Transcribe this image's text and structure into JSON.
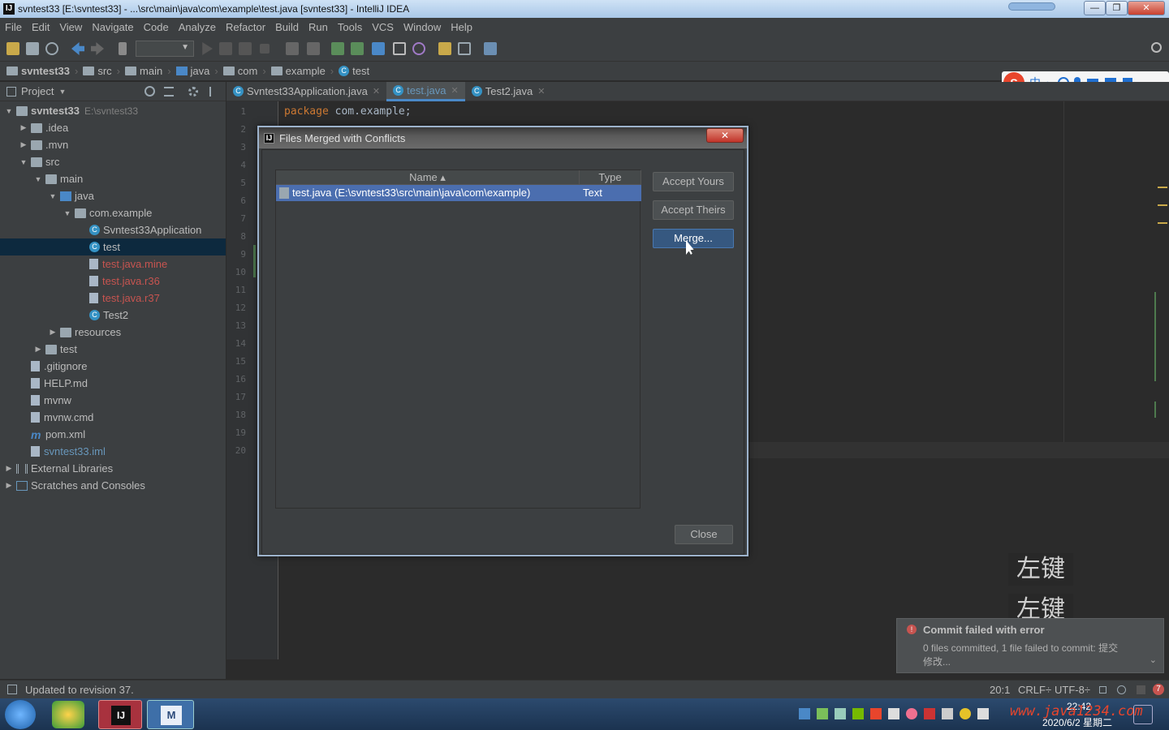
{
  "window": {
    "title": "svntest33 [E:\\svntest33] - ...\\src\\main\\java\\com\\example\\test.java [svntest33] - IntelliJ IDEA",
    "minimize": "—",
    "maximize": "❐",
    "close": "✕"
  },
  "menu": [
    "File",
    "Edit",
    "View",
    "Navigate",
    "Code",
    "Analyze",
    "Refactor",
    "Build",
    "Run",
    "Tools",
    "VCS",
    "Window",
    "Help"
  ],
  "breadcrumb": [
    "svntest33",
    "src",
    "main",
    "java",
    "com",
    "example",
    "test"
  ],
  "project_panel": {
    "title": "Project",
    "tree": [
      {
        "label": "svntest33",
        "extra": "E:\\svntest33",
        "indent": 0,
        "arrow": "▼",
        "icon": "module",
        "style": "bold"
      },
      {
        "label": ".idea",
        "indent": 1,
        "arrow": "▶",
        "icon": "folder"
      },
      {
        "label": ".mvn",
        "indent": 1,
        "arrow": "▶",
        "icon": "folder"
      },
      {
        "label": "src",
        "indent": 1,
        "arrow": "▼",
        "icon": "folder"
      },
      {
        "label": "main",
        "indent": 2,
        "arrow": "▼",
        "icon": "folder"
      },
      {
        "label": "java",
        "indent": 3,
        "arrow": "▼",
        "icon": "folder-blue"
      },
      {
        "label": "com.example",
        "indent": 4,
        "arrow": "▼",
        "icon": "package"
      },
      {
        "label": "Svntest33Application",
        "indent": 5,
        "arrow": "",
        "icon": "class"
      },
      {
        "label": "test",
        "indent": 5,
        "arrow": "",
        "icon": "class",
        "selected": true
      },
      {
        "label": "test.java.mine",
        "indent": 5,
        "arrow": "",
        "icon": "file",
        "style": "red"
      },
      {
        "label": "test.java.r36",
        "indent": 5,
        "arrow": "",
        "icon": "file",
        "style": "red"
      },
      {
        "label": "test.java.r37",
        "indent": 5,
        "arrow": "",
        "icon": "file",
        "style": "red"
      },
      {
        "label": "Test2",
        "indent": 5,
        "arrow": "",
        "icon": "class"
      },
      {
        "label": "resources",
        "indent": 3,
        "arrow": "▶",
        "icon": "folder"
      },
      {
        "label": "test",
        "indent": 2,
        "arrow": "▶",
        "icon": "folder"
      },
      {
        "label": ".gitignore",
        "indent": 1,
        "arrow": "",
        "icon": "file"
      },
      {
        "label": "HELP.md",
        "indent": 1,
        "arrow": "",
        "icon": "file"
      },
      {
        "label": "mvnw",
        "indent": 1,
        "arrow": "",
        "icon": "file"
      },
      {
        "label": "mvnw.cmd",
        "indent": 1,
        "arrow": "",
        "icon": "file"
      },
      {
        "label": "pom.xml",
        "indent": 1,
        "arrow": "",
        "icon": "maven"
      },
      {
        "label": "svntest33.iml",
        "indent": 1,
        "arrow": "",
        "icon": "file",
        "style": "blue"
      },
      {
        "label": "External Libraries",
        "indent": 0,
        "arrow": "▶",
        "icon": "libs"
      },
      {
        "label": "Scratches and Consoles",
        "indent": 0,
        "arrow": "▶",
        "icon": "scratch"
      }
    ]
  },
  "tabs": [
    {
      "label": "Svntest33Application.java",
      "active": false
    },
    {
      "label": "test.java",
      "active": true
    },
    {
      "label": "Test2.java",
      "active": false
    }
  ],
  "editor": {
    "line_numbers": [
      "1",
      "2",
      "3",
      "4",
      "5",
      "6",
      "7",
      "8",
      "9",
      "10",
      "11",
      "12",
      "13",
      "14",
      "15",
      "16",
      "17",
      "18",
      "19",
      "20"
    ],
    "code_keyword": "package",
    "code_rest": " com.example;"
  },
  "dialog": {
    "title": "Files Merged with Conflicts",
    "close": "✕",
    "col_name": "Name ▴",
    "col_type": "Type",
    "row_file": "test.java (E:\\svntest33\\src\\main\\java\\com\\example)",
    "row_type": "Text",
    "accept_yours": "Accept Yours",
    "accept_theirs": "Accept Theirs",
    "merge": "Merge...",
    "close_button": "Close"
  },
  "notification": {
    "title": "Commit failed with error",
    "body": "0 files committed, 1 file failed to commit: 提交",
    "body2": "修改..."
  },
  "overlay_keys": [
    "左键",
    "左键"
  ],
  "ime": {
    "logo": "S",
    "mode": "中",
    "punct": "•,"
  },
  "status": {
    "message": "Updated to revision 37.",
    "position": "20:1",
    "line_sep": "CRLF÷",
    "encoding": "UTF-8÷",
    "badge": "7"
  },
  "taskbar": {
    "time": "22:42",
    "date": "2020/6/2 星期二",
    "watermark": "www.java1234.com"
  }
}
